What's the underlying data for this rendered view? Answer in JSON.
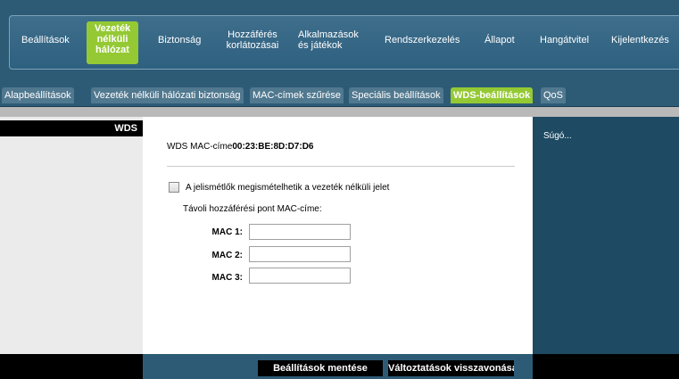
{
  "main_nav": [
    {
      "label": "Beállítások",
      "active": false
    },
    {
      "label": "Vezeték nélküli hálózat",
      "active": true
    },
    {
      "label": "Biztonság",
      "active": false
    },
    {
      "label": "Hozzáférés korlátozásai",
      "active": false
    },
    {
      "label": "Alkalmazások és játékok",
      "active": false
    },
    {
      "label": "Rendszerkezelés",
      "active": false
    },
    {
      "label": "Állapot",
      "active": false
    },
    {
      "label": "Hangátvitel",
      "active": false
    },
    {
      "label": "Kijelentkezés",
      "active": false
    }
  ],
  "sub_tabs": [
    {
      "label": "Alapbeállítások",
      "active": false
    },
    {
      "label": "Vezeték nélküli hálózati biztonság",
      "active": false
    },
    {
      "label": "MAC-címek szűrése",
      "active": false
    },
    {
      "label": "Speciális beállítások",
      "active": false
    },
    {
      "label": "WDS-beállítások",
      "active": true
    },
    {
      "label": "QoS",
      "active": false
    }
  ],
  "section": {
    "title": "WDS"
  },
  "wds": {
    "mac_label": "WDS MAC-címe",
    "mac_value": "00:23:BE:8D:D7:D6",
    "repeat_checkbox_label": "A jelismétlők megismételhetik a vezeték nélküli jelet",
    "repeat_checked": false,
    "remote_ap_label": "Távoli hozzáférési pont MAC-címe:",
    "mac_fields": [
      {
        "label": "MAC 1:",
        "value": ""
      },
      {
        "label": "MAC 2:",
        "value": ""
      },
      {
        "label": "MAC 3:",
        "value": ""
      }
    ]
  },
  "help": {
    "label": "Súgó..."
  },
  "footer": {
    "save_label": "Beállítások mentése",
    "cancel_label": "Változtatások visszavonása"
  },
  "colors": {
    "header_bg": "#2d5b76",
    "active_tab": "#94c934",
    "right_panel": "#1e4a63"
  }
}
